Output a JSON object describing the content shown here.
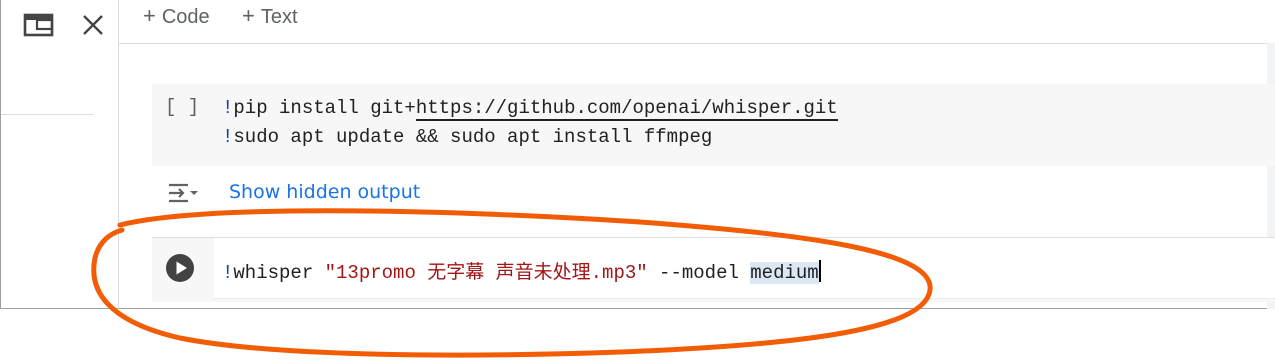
{
  "window_controls": {
    "restore_icon": "window-restore-icon",
    "close_icon": "close-icon"
  },
  "toolbar": {
    "add_code_label": "Code",
    "add_text_label": "Text",
    "plus": "+"
  },
  "cells": [
    {
      "run_indicator": "[ ]",
      "lines": [
        {
          "bang": "!",
          "command": "pip install git+",
          "link": "https://github.com/openai/whisper.git"
        },
        {
          "bang": "!",
          "command": "sudo apt update && sudo apt install ffmpeg"
        }
      ],
      "output_toggle": "Show hidden output"
    },
    {
      "bang": "!",
      "command": "whisper ",
      "string": "\"13promo 无字幕 声音未处理.mp3\"",
      "args": " --model ",
      "selected": "medium"
    }
  ],
  "annotation": {
    "color": "#f25c05",
    "shape": "hand-drawn ellipse"
  },
  "colors": {
    "link": "#1a73e8",
    "string": "#a31515",
    "keyword": "#0d47a1",
    "cell_bg": "#f7f7f7"
  }
}
